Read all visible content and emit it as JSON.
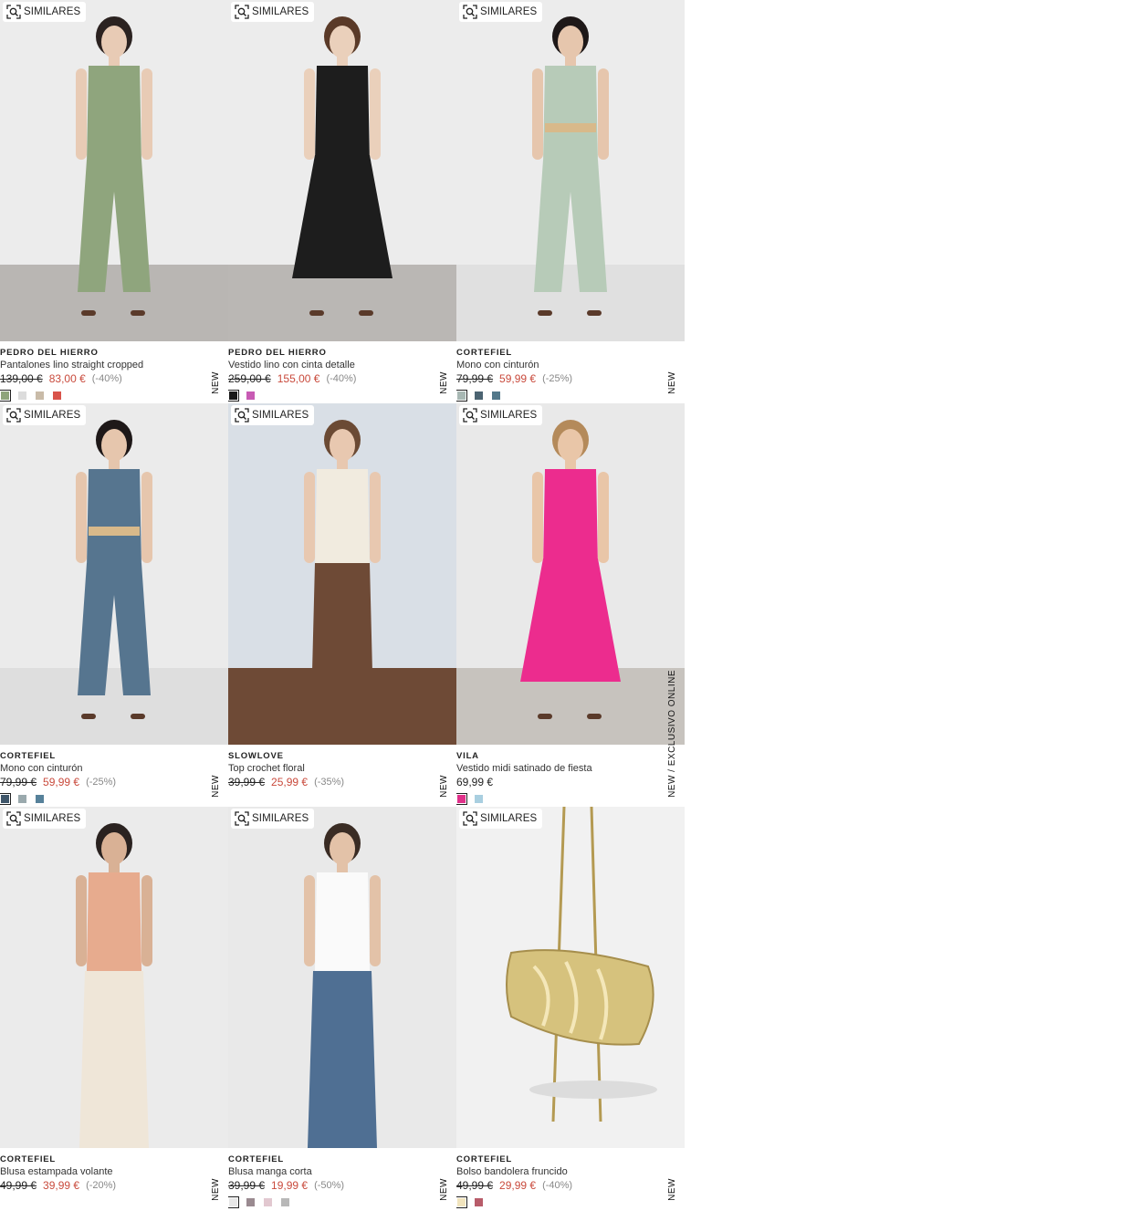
{
  "similares_label": "SIMILARES",
  "products": [
    {
      "brand": "PEDRO DEL HIERRO",
      "name": "Pantalones lino straight cropped",
      "old_price": "139,00 €",
      "price": "83,00 €",
      "discount": "(-40%)",
      "tag": "NEW",
      "swatches": [
        "#8ea47a",
        "#dcdcdc",
        "#c9bba8",
        "#d9534a"
      ],
      "bg": "#ececec",
      "floor": "#b9b6b3",
      "garment": "#8fa57d",
      "skin": "#e8cbb5",
      "hair": "#2b2220"
    },
    {
      "brand": "PEDRO DEL HIERRO",
      "name": "Vestido lino con cinta detalle",
      "old_price": "259,00 €",
      "price": "155,00 €",
      "discount": "(-40%)",
      "tag": "NEW",
      "swatches": [
        "#1a1a1a",
        "#c85bb4"
      ],
      "bg": "#ececec",
      "floor": "#bab7b4",
      "garment": "#1d1d1d",
      "skin": "#ead0bb",
      "hair": "#5a3a28"
    },
    {
      "brand": "CORTEFIEL",
      "name": "Mono con cinturón",
      "old_price": "79,99 €",
      "price": "59,99 €",
      "discount": "(-25%)",
      "tag": "NEW",
      "swatches": [
        "#a8b8b4",
        "#4c6472",
        "#53788a"
      ],
      "bg": "#ececec",
      "floor": "#e0e0e0",
      "garment": "#b7cbb8",
      "skin": "#e6c6ad",
      "hair": "#1e1818"
    },
    {
      "brand": "CORTEFIEL",
      "name": "Mono con cinturón",
      "old_price": "79,99 €",
      "price": "59,99 €",
      "discount": "(-25%)",
      "tag": "NEW",
      "swatches": [
        "#3f566a",
        "#9aa9ad",
        "#56819a"
      ],
      "bg": "#ebebeb",
      "floor": "#dedede",
      "garment": "#56758f",
      "skin": "#e6c6ad",
      "hair": "#1e1818"
    },
    {
      "brand": "SLOWLOVE",
      "name": "Top crochet floral",
      "old_price": "39,99 €",
      "price": "25,99 €",
      "discount": "(-35%)",
      "tag": "NEW",
      "swatches": [],
      "bg": "#d9dfe6",
      "floor": "#6e4a36",
      "garment": "#f1ebdf",
      "skin": "#e8c8b0",
      "hair": "#6b4a34"
    },
    {
      "brand": "VILA",
      "name": "Vestido midi satinado de fiesta",
      "old_price": "",
      "price": "69,99 €",
      "discount": "",
      "tag": "NEW  /  EXCLUSIVO ONLINE",
      "swatches": [
        "#e0318a",
        "#a9cfe0"
      ],
      "bg": "#e9e9e9",
      "floor": "#c7c3be",
      "garment": "#ec2c8e",
      "skin": "#e9c6a8",
      "hair": "#b48a5a"
    },
    {
      "brand": "CORTEFIEL",
      "name": "Blusa estampada volante",
      "old_price": "49,99 €",
      "price": "39,99 €",
      "discount": "(-20%)",
      "tag": "NEW",
      "swatches": [],
      "bg": "#ebebeb",
      "floor": "#ebebeb",
      "garment": "#e7ab8e",
      "skin": "#d9b195",
      "hair": "#2a2220"
    },
    {
      "brand": "CORTEFIEL",
      "name": "Blusa manga corta",
      "old_price": "39,99 €",
      "price": "19,99 €",
      "discount": "(-50%)",
      "tag": "NEW",
      "swatches": [
        "#e8e8e8",
        "#9a8a90",
        "#e2c8d0",
        "#b8b8b8"
      ],
      "bg": "#e9e9e9",
      "floor": "#e9e9e9",
      "garment": "#fafafa",
      "skin": "#e3c2a8",
      "hair": "#3a2c24"
    },
    {
      "brand": "CORTEFIEL",
      "name": "Bolso bandolera fruncido",
      "old_price": "49,99 €",
      "price": "29,99 €",
      "discount": "(-40%)",
      "tag": "NEW",
      "swatches": [
        "#f1e4bd",
        "#b85c6a"
      ],
      "bg": "#f1f1f1",
      "floor": "#f1f1f1",
      "garment": "#d6c27d",
      "skin": "#000000",
      "hair": "#000000"
    }
  ]
}
